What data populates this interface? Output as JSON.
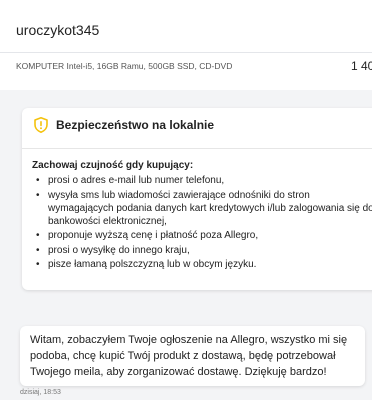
{
  "header": {
    "username": "uroczykot345",
    "product": "KOMPUTER Intel-i5, 16GB Ramu, 500GB SSD, CD-DVD",
    "price": "1 40"
  },
  "security": {
    "title": "Bezpieczeństwo na lokalnie",
    "icon": "shield-alert-icon",
    "accent_color": "#f4c20d",
    "heading": "Zachowaj czujność gdy kupujący:",
    "items": [
      "prosi o adres e-mail lub numer telefonu,",
      "wysyła sms lub wiadomości zawierające odnośniki do stron wymagających podania danych kart kredytowych i/lub zalogowania się do bankowości elektronicznej,",
      "proponuje wyższą cenę i płatność poza Allegro,",
      "prosi o wysyłkę do innego kraju,",
      "pisze łamaną polszczyzną lub w obcym języku."
    ]
  },
  "message": {
    "text": "Witam, zobaczyłem Twoje ogłoszenie na Allegro, wszystko mi się podoba, chcę kupić Twój produkt z dostawą, będę potrzebował Twojego meila, aby zorganizować dostawę. Dziękuję bardzo!",
    "timestamp": "dzisiaj, 18:53"
  }
}
